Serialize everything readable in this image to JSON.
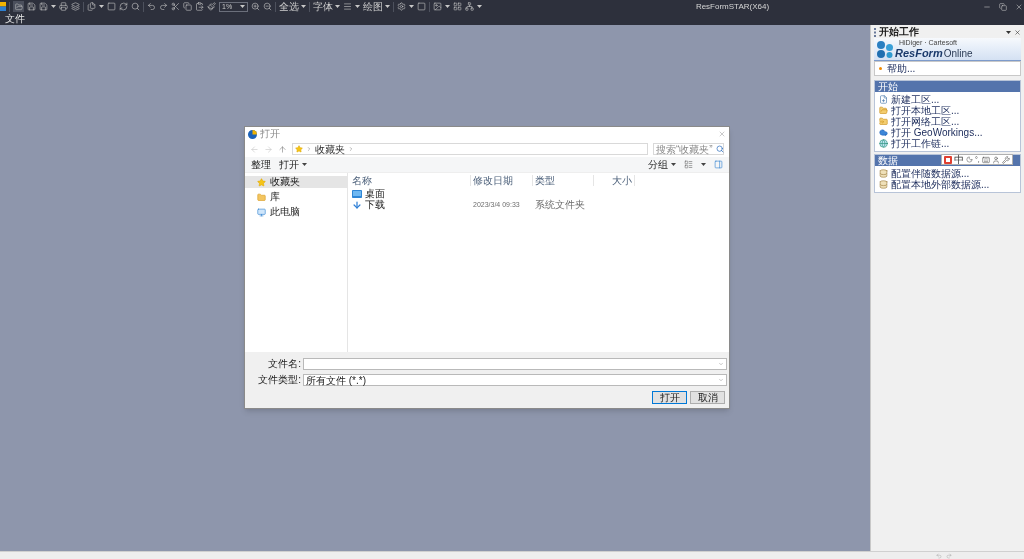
{
  "app": {
    "title": "ResFormSTAR(X64)",
    "menu": [
      "文件"
    ]
  },
  "toolbar": {
    "zoom": "1%",
    "menus": [
      "全选",
      "字体",
      "绘图"
    ]
  },
  "dialog": {
    "title": "打开",
    "address": [
      "收藏夹"
    ],
    "search": {
      "placeholder": "搜索“收藏夹”"
    },
    "commands": [
      {
        "label": "整理",
        "dropdown": false
      },
      {
        "label": "打开",
        "dropdown": true
      }
    ],
    "view_commands": [
      {
        "label": "分组",
        "dropdown": true
      }
    ],
    "nav_pane": [
      {
        "kind": "favorites",
        "label": "收藏夹",
        "selected": true
      },
      {
        "kind": "library",
        "label": "库",
        "selected": false
      },
      {
        "kind": "computer",
        "label": "此电脑",
        "selected": false
      }
    ],
    "columns": [
      "名称",
      "修改日期",
      "类型",
      "大小"
    ],
    "rows": [
      {
        "kind": "desktop",
        "name": "桌面"
      },
      {
        "kind": "downloads",
        "name": "下载",
        "modified": "2023/3/4 09:33",
        "type": "系统文件夹"
      }
    ],
    "file_name": {
      "label": "文件名:"
    },
    "file_type": {
      "label": "文件类型:",
      "value": "所有文件 (*.*)"
    },
    "buttons": [
      {
        "label": "打开",
        "default": true
      },
      {
        "label": "取消",
        "default": false
      }
    ]
  },
  "start_panel": {
    "title": "开始工作",
    "logo": {
      "tagline": "HiDiger · Cartesoft",
      "name": "ResForm",
      "suffix": "Online"
    },
    "help": "帮助...",
    "sections": [
      {
        "title": "开始",
        "items": [
          {
            "kind": "new",
            "label": "新建工区..."
          },
          {
            "kind": "folder",
            "label": "打开本地工区..."
          },
          {
            "kind": "netfolder",
            "label": "打开网络工区..."
          },
          {
            "kind": "cloud",
            "label": "打开 GeoWorkings..."
          },
          {
            "kind": "globe",
            "label": "打开工作链..."
          }
        ]
      },
      {
        "title": "数据",
        "items": [
          {
            "kind": "database",
            "label": "配置伴随数据源..."
          },
          {
            "kind": "database",
            "label": "配置本地外部数据源..."
          }
        ]
      }
    ]
  },
  "ime_bar": {
    "mode": "中",
    "punctuation": "°,"
  }
}
